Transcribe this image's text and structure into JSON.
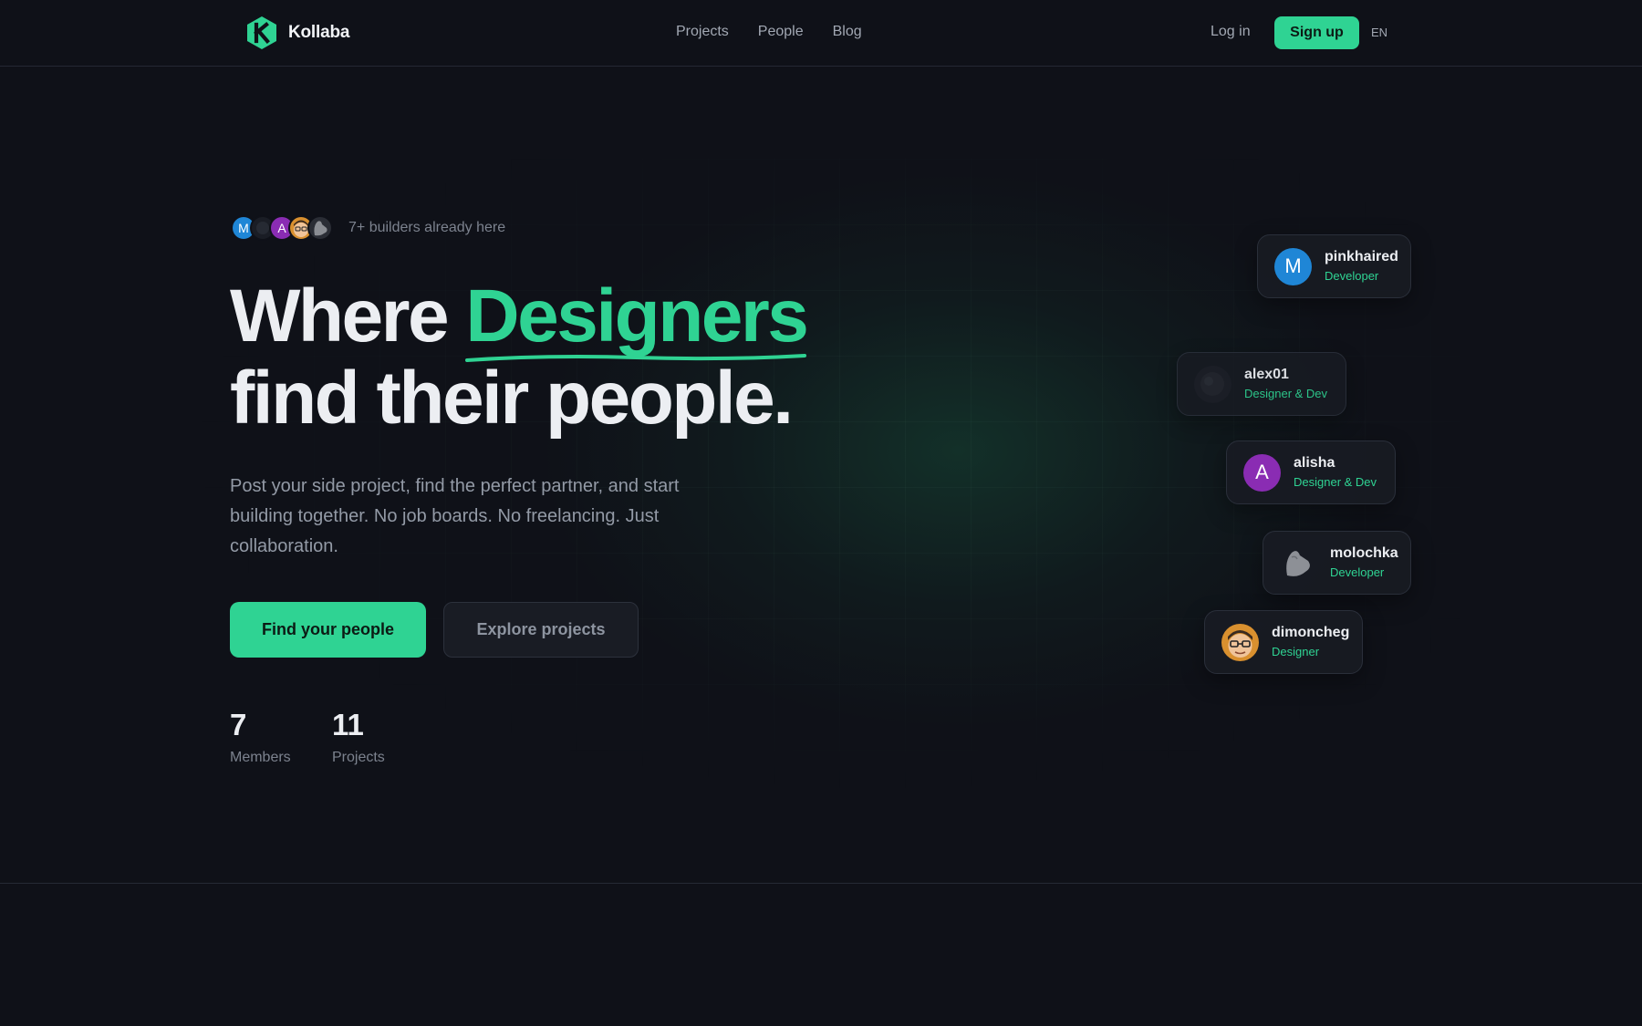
{
  "brand": {
    "name": "Kollaba",
    "logo_letter": "K",
    "accent_color": "#2fd393"
  },
  "nav": {
    "items": [
      {
        "label": "Projects"
      },
      {
        "label": "People"
      },
      {
        "label": "Blog"
      }
    ],
    "login_label": "Log in",
    "signup_label": "Sign up",
    "language": "EN"
  },
  "hero": {
    "builders_text": "7+ builders already here",
    "avatar_initials": [
      "M",
      "A"
    ],
    "headline": {
      "part1": "Where ",
      "accent": "Designers",
      "part2": "find their people."
    },
    "subtitle": "Post your side project, find the perfect partner, and start building together. No job boards. No freelancing. Just collaboration.",
    "primary_cta": "Find your people",
    "secondary_cta": "Explore projects",
    "stats": [
      {
        "value": "7",
        "label": "Members"
      },
      {
        "value": "11",
        "label": "Projects"
      }
    ]
  },
  "people_cards": [
    {
      "name": "pinkhaired",
      "role": "Developer",
      "initial": "M",
      "avatar_color": "#1f86d6"
    },
    {
      "name": "alex01",
      "role": "Designer & Dev",
      "initial": "",
      "avatar_color": "#1c1f27"
    },
    {
      "name": "alisha",
      "role": "Designer & Dev",
      "initial": "A",
      "avatar_color": "#8a2cb3"
    },
    {
      "name": "molochka",
      "role": "Developer",
      "initial": "",
      "avatar_color": "#2a2d35"
    },
    {
      "name": "dimoncheg",
      "role": "Designer",
      "initial": "",
      "avatar_color": "#d9902f"
    }
  ]
}
